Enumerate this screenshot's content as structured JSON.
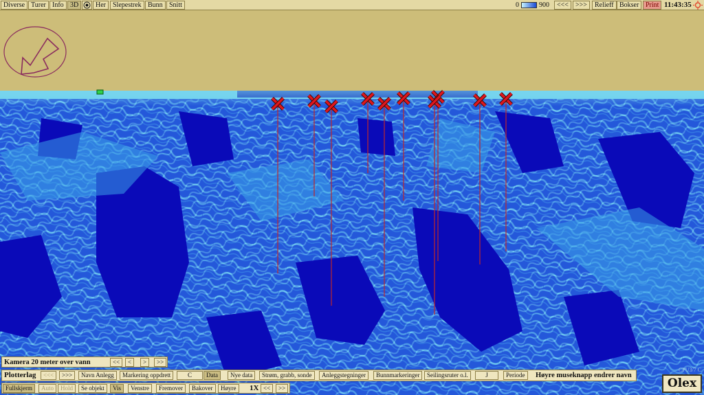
{
  "toolbar": {
    "menu": [
      "Diverse",
      "Turer",
      "Info",
      "3D",
      "Her",
      "Slepestrek",
      "Bunn",
      "Snitt"
    ],
    "scale_min": "0",
    "scale_max": "900",
    "nav_back": "<<<",
    "nav_fwd": ">>>",
    "relief": "Relieff",
    "bokser": "Bokser",
    "print": "Print",
    "clock": "11:43:35"
  },
  "camera": {
    "label": "Kamera 20 meter over vann",
    "buttons": [
      "<<",
      "<",
      ">",
      ">>"
    ]
  },
  "plotterlag": {
    "title": "Plotterlag",
    "items": [
      "<<<",
      ">>>",
      "Navn Anlegg",
      "Markering oppdrett",
      "C",
      "Data",
      "Nye data",
      "Strøm, grabb, sonde",
      "Anleggstegninger",
      "Bunnmarkeringer",
      "Seilingsruter o.l.",
      "J",
      "Periode"
    ],
    "hint": "Høyre museknapp endrer navn"
  },
  "bottom": {
    "items": [
      "Fullskjerm",
      "Auto",
      "Hold",
      "Se objekt",
      "Vis",
      "Venstre",
      "Fremover",
      "Bakover",
      "Høyre"
    ],
    "zoom": "1X",
    "zoom_nav": [
      "<<",
      ">>"
    ]
  },
  "logo": "Olex",
  "watermark": "CPU3/7 C",
  "colors": {
    "deep": "#0a0ab8",
    "mid": "#1e4fd8",
    "shallow": "#59c0ea",
    "marker": "#e0171c",
    "sky": "#cdbd79"
  },
  "markers_count": 12
}
